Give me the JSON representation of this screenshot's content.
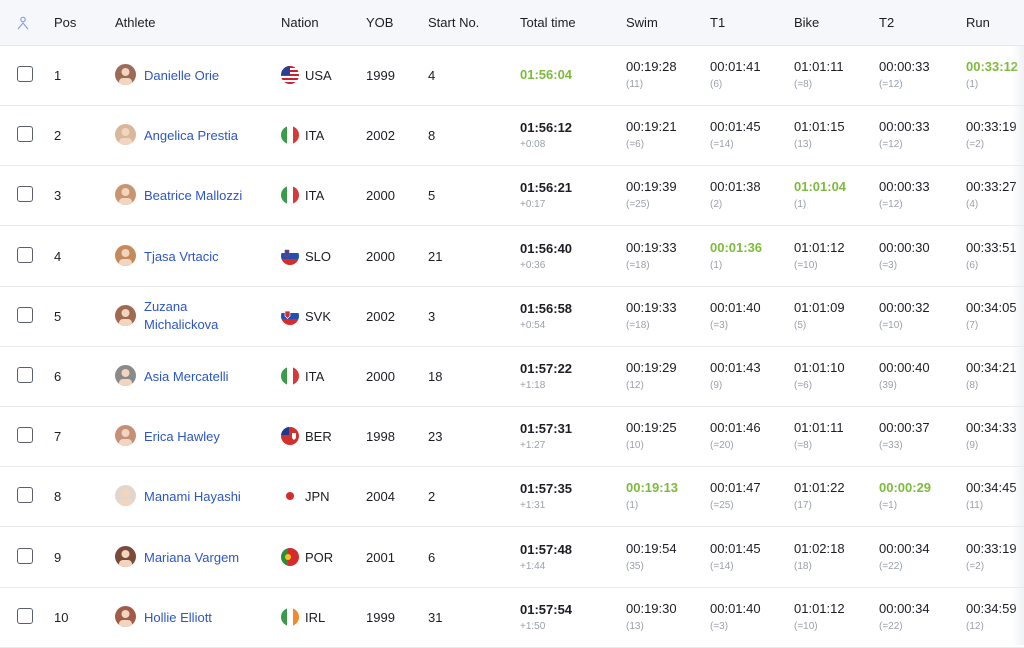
{
  "header": {
    "sort_icon": "person-sort-icon",
    "pos": "Pos",
    "athlete": "Athlete",
    "nation": "Nation",
    "yob": "YOB",
    "start_no": "Start No.",
    "total_time": "Total time",
    "swim": "Swim",
    "t1": "T1",
    "bike": "Bike",
    "t2": "T2",
    "run": "Run"
  },
  "colors": {
    "accent_green": "#7dbb3c",
    "link_blue": "#2c55c9"
  },
  "rows": [
    {
      "pos": "1",
      "name": "Danielle Orie",
      "flag": "usa-flag",
      "nation": "USA",
      "yob": "1999",
      "start": "4",
      "total": "01:56:04",
      "gap": "",
      "swim": "00:19:28",
      "swim_r": "(11)",
      "t1": "00:01:41",
      "t1_r": "(6)",
      "bike": "01:01:11",
      "bike_r": "(=8)",
      "t2": "00:00:33",
      "t2_r": "(=12)",
      "run": "00:33:12",
      "run_r": "(1)"
    },
    {
      "pos": "2",
      "name": "Angelica Prestia",
      "flag": "italy-flag",
      "nation": "ITA",
      "yob": "2002",
      "start": "8",
      "total": "01:56:12",
      "gap": "+0:08",
      "swim": "00:19:21",
      "swim_r": "(=6)",
      "t1": "00:01:45",
      "t1_r": "(=14)",
      "bike": "01:01:15",
      "bike_r": "(13)",
      "t2": "00:00:33",
      "t2_r": "(=12)",
      "run": "00:33:19",
      "run_r": "(=2)"
    },
    {
      "pos": "3",
      "name": "Beatrice Mallozzi",
      "flag": "italy-flag",
      "nation": "ITA",
      "yob": "2000",
      "start": "5",
      "total": "01:56:21",
      "gap": "+0:17",
      "swim": "00:19:39",
      "swim_r": "(=25)",
      "t1": "00:01:38",
      "t1_r": "(2)",
      "bike": "01:01:04",
      "bike_r": "(1)",
      "t2": "00:00:33",
      "t2_r": "(=12)",
      "run": "00:33:27",
      "run_r": "(4)"
    },
    {
      "pos": "4",
      "name": "Tjasa Vrtacic",
      "flag": "slovenia-flag",
      "nation": "SLO",
      "yob": "2000",
      "start": "21",
      "total": "01:56:40",
      "gap": "+0:36",
      "swim": "00:19:33",
      "swim_r": "(=18)",
      "t1": "00:01:36",
      "t1_r": "(1)",
      "bike": "01:01:12",
      "bike_r": "(=10)",
      "t2": "00:00:30",
      "t2_r": "(=3)",
      "run": "00:33:51",
      "run_r": "(6)"
    },
    {
      "pos": "5",
      "name_line1": "Zuzana",
      "name_line2": "Michalickova",
      "flag": "slovakia-flag",
      "nation": "SVK",
      "yob": "2002",
      "start": "3",
      "total": "01:56:58",
      "gap": "+0:54",
      "swim": "00:19:33",
      "swim_r": "(=18)",
      "t1": "00:01:40",
      "t1_r": "(=3)",
      "bike": "01:01:09",
      "bike_r": "(5)",
      "t2": "00:00:32",
      "t2_r": "(=10)",
      "run": "00:34:05",
      "run_r": "(7)"
    },
    {
      "pos": "6",
      "name": "Asia Mercatelli",
      "flag": "italy-flag",
      "nation": "ITA",
      "yob": "2000",
      "start": "18",
      "total": "01:57:22",
      "gap": "+1:18",
      "swim": "00:19:29",
      "swim_r": "(12)",
      "t1": "00:01:43",
      "t1_r": "(9)",
      "bike": "01:01:10",
      "bike_r": "(=6)",
      "t2": "00:00:40",
      "t2_r": "(39)",
      "run": "00:34:21",
      "run_r": "(8)"
    },
    {
      "pos": "7",
      "name": "Erica Hawley",
      "flag": "bermuda-flag",
      "nation": "BER",
      "yob": "1998",
      "start": "23",
      "total": "01:57:31",
      "gap": "+1:27",
      "swim": "00:19:25",
      "swim_r": "(10)",
      "t1": "00:01:46",
      "t1_r": "(=20)",
      "bike": "01:01:11",
      "bike_r": "(=8)",
      "t2": "00:00:37",
      "t2_r": "(=33)",
      "run": "00:34:33",
      "run_r": "(9)"
    },
    {
      "pos": "8",
      "name": "Manami Hayashi",
      "flag": "japan-flag",
      "nation": "JPN",
      "yob": "2004",
      "start": "2",
      "total": "01:57:35",
      "gap": "+1:31",
      "swim": "00:19:13",
      "swim_r": "(1)",
      "t1": "00:01:47",
      "t1_r": "(=25)",
      "bike": "01:01:22",
      "bike_r": "(17)",
      "t2": "00:00:29",
      "t2_r": "(=1)",
      "run": "00:34:45",
      "run_r": "(11)"
    },
    {
      "pos": "9",
      "name": "Mariana Vargem",
      "flag": "portugal-flag",
      "nation": "POR",
      "yob": "2001",
      "start": "6",
      "total": "01:57:48",
      "gap": "+1:44",
      "swim": "00:19:54",
      "swim_r": "(35)",
      "t1": "00:01:45",
      "t1_r": "(=14)",
      "bike": "01:02:18",
      "bike_r": "(18)",
      "t2": "00:00:34",
      "t2_r": "(=22)",
      "run": "00:33:19",
      "run_r": "(=2)"
    },
    {
      "pos": "10",
      "name": "Hollie Elliott",
      "flag": "ireland-flag",
      "nation": "IRL",
      "yob": "1999",
      "start": "31",
      "total": "01:57:54",
      "gap": "+1:50",
      "swim": "00:19:30",
      "swim_r": "(13)",
      "t1": "00:01:40",
      "t1_r": "(=3)",
      "bike": "01:01:12",
      "bike_r": "(=10)",
      "t2": "00:00:34",
      "t2_r": "(=22)",
      "run": "00:34:59",
      "run_r": "(12)"
    }
  ]
}
